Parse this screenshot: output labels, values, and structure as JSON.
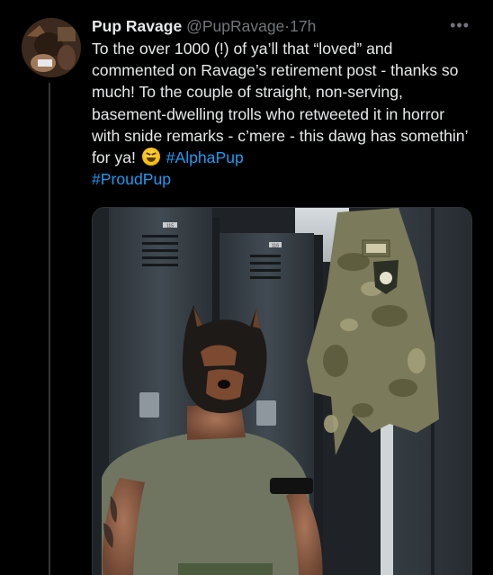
{
  "author": {
    "display_name": "Pup Ravage",
    "handle": "@PupRavage",
    "separator": "·",
    "time": "17h"
  },
  "menu_icon": "more-horizontal-icon",
  "tweet": {
    "text_1": "To the over 1000 (!) of ya’ll that “loved” and commented on Ravage’s retirement post - thanks so much! To the couple of straight, non-serving, basement-dwelling trolls who retweeted it in horror with snide remarks - c’mere - this dawg has somethin’ for ya! ",
    "emoji": "grinning-squinting-face",
    "hashtags": [
      "#AlphaPup",
      "#ProudPup"
    ]
  },
  "media": {
    "locker_plate_1": "115",
    "locker_plate_2": "116"
  },
  "colors": {
    "background": "#000000",
    "text": "#e7e9ea",
    "muted": "#71767b",
    "link": "#1d9bf0"
  }
}
